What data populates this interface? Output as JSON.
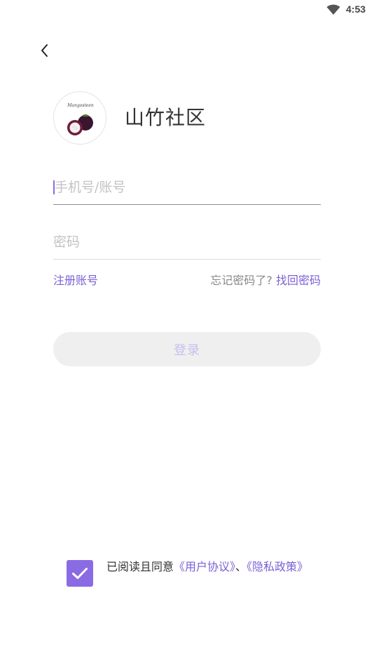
{
  "status_bar": {
    "time": "4:53",
    "wifi_icon": "wifi-icon"
  },
  "nav": {
    "back_icon": "chevron-left-icon"
  },
  "app": {
    "logo_text": "Mangosteen",
    "title": "山竹社区"
  },
  "form": {
    "phone_placeholder": "手机号/账号",
    "phone_value": "",
    "password_placeholder": "密码",
    "password_value": ""
  },
  "links": {
    "register": "注册账号",
    "forgot_prompt": "忘记密码了?",
    "recover": "找回密码"
  },
  "login_button": "登录",
  "agreement": {
    "checked": true,
    "prefix": "已阅读且同意",
    "user_agreement": "《用户协议》",
    "separator": "、",
    "privacy_policy": "《隐私政策》"
  },
  "colors": {
    "accent": "#7b5fd6",
    "checkbox": "#8b6be3",
    "button_bg": "#efefef",
    "button_text": "#c9bdf0"
  }
}
